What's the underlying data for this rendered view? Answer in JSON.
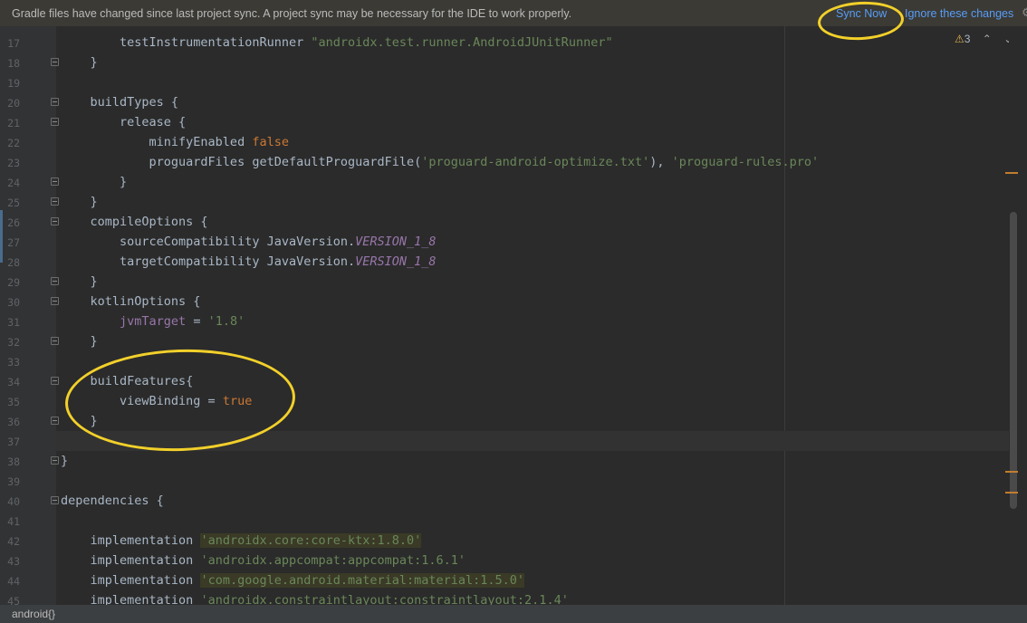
{
  "notification": {
    "message": "Gradle files have changed since last project sync. A project sync may be necessary for the IDE to work properly.",
    "sync_now": "Sync Now",
    "ignore": "Ignore these changes"
  },
  "toolbar": {
    "warning_count": "3",
    "warning_glyph": "⚠",
    "prev_glyph": "⌃",
    "next_glyph": "⌄"
  },
  "status_bar": {
    "breadcrumb": "android{}"
  },
  "colors": {
    "keyword": "#cc7832",
    "string": "#6a8759",
    "constant": "#9876aa",
    "link": "#589df6",
    "annotation": "#f2d02a"
  },
  "lines": [
    {
      "n": "17",
      "tokens": [
        [
          "p",
          "        testInstrumentationRunner "
        ],
        [
          "str",
          "\"androidx.test.runner.AndroidJUnitRunner\""
        ]
      ]
    },
    {
      "n": "18",
      "tokens": [
        [
          "p",
          "    }"
        ]
      ]
    },
    {
      "n": "19",
      "tokens": []
    },
    {
      "n": "20",
      "tokens": [
        [
          "p",
          "    buildTypes {"
        ]
      ]
    },
    {
      "n": "21",
      "tokens": [
        [
          "p",
          "        release {"
        ]
      ]
    },
    {
      "n": "22",
      "tokens": [
        [
          "p",
          "            minifyEnabled "
        ],
        [
          "kw",
          "false"
        ]
      ]
    },
    {
      "n": "23",
      "tokens": [
        [
          "p",
          "            proguardFiles getDefaultProguardFile("
        ],
        [
          "str",
          "'proguard-android-optimize.txt'"
        ],
        [
          "p",
          "), "
        ],
        [
          "str",
          "'proguard-rules.pro'"
        ]
      ]
    },
    {
      "n": "24",
      "tokens": [
        [
          "p",
          "        }"
        ]
      ]
    },
    {
      "n": "25",
      "tokens": [
        [
          "p",
          "    }"
        ]
      ]
    },
    {
      "n": "26",
      "tokens": [
        [
          "p",
          "    compileOptions {"
        ]
      ]
    },
    {
      "n": "27",
      "tokens": [
        [
          "p",
          "        sourceCompatibility JavaVersion."
        ],
        [
          "ital",
          "VERSION_1_8"
        ]
      ]
    },
    {
      "n": "28",
      "tokens": [
        [
          "p",
          "        targetCompatibility JavaVersion."
        ],
        [
          "ital",
          "VERSION_1_8"
        ]
      ]
    },
    {
      "n": "29",
      "tokens": [
        [
          "p",
          "    }"
        ]
      ]
    },
    {
      "n": "30",
      "tokens": [
        [
          "p",
          "    kotlinOptions {"
        ]
      ]
    },
    {
      "n": "31",
      "tokens": [
        [
          "p",
          "        "
        ],
        [
          "fn",
          "jvmTarget"
        ],
        [
          "p",
          " = "
        ],
        [
          "str",
          "'1.8'"
        ]
      ]
    },
    {
      "n": "32",
      "tokens": [
        [
          "p",
          "    }"
        ]
      ]
    },
    {
      "n": "33",
      "tokens": []
    },
    {
      "n": "34",
      "tokens": [
        [
          "p",
          "    buildFeatures{"
        ]
      ]
    },
    {
      "n": "35",
      "tokens": [
        [
          "p",
          "        viewBinding = "
        ],
        [
          "kw",
          "true"
        ]
      ]
    },
    {
      "n": "36",
      "tokens": [
        [
          "p",
          "    }"
        ]
      ]
    },
    {
      "n": "37",
      "tokens": []
    },
    {
      "n": "38",
      "tokens": [
        [
          "p",
          "}"
        ]
      ]
    },
    {
      "n": "39",
      "tokens": []
    },
    {
      "n": "40",
      "tokens": [
        [
          "p",
          "dependencies {"
        ]
      ]
    },
    {
      "n": "41",
      "tokens": []
    },
    {
      "n": "42",
      "tokens": [
        [
          "p",
          "    implementation "
        ],
        [
          "strhl",
          "'androidx.core:core-ktx:1.8.0'"
        ]
      ]
    },
    {
      "n": "43",
      "tokens": [
        [
          "p",
          "    implementation "
        ],
        [
          "str",
          "'androidx.appcompat:appcompat:1.6.1'"
        ]
      ]
    },
    {
      "n": "44",
      "tokens": [
        [
          "p",
          "    implementation "
        ],
        [
          "strhl",
          "'com.google.android.material:material:1.5.0'"
        ]
      ]
    },
    {
      "n": "45",
      "tokens": [
        [
          "p",
          "    implementation "
        ],
        [
          "str",
          "'androidx.constraintlayout:constraintlayout:2.1.4'"
        ]
      ]
    }
  ]
}
